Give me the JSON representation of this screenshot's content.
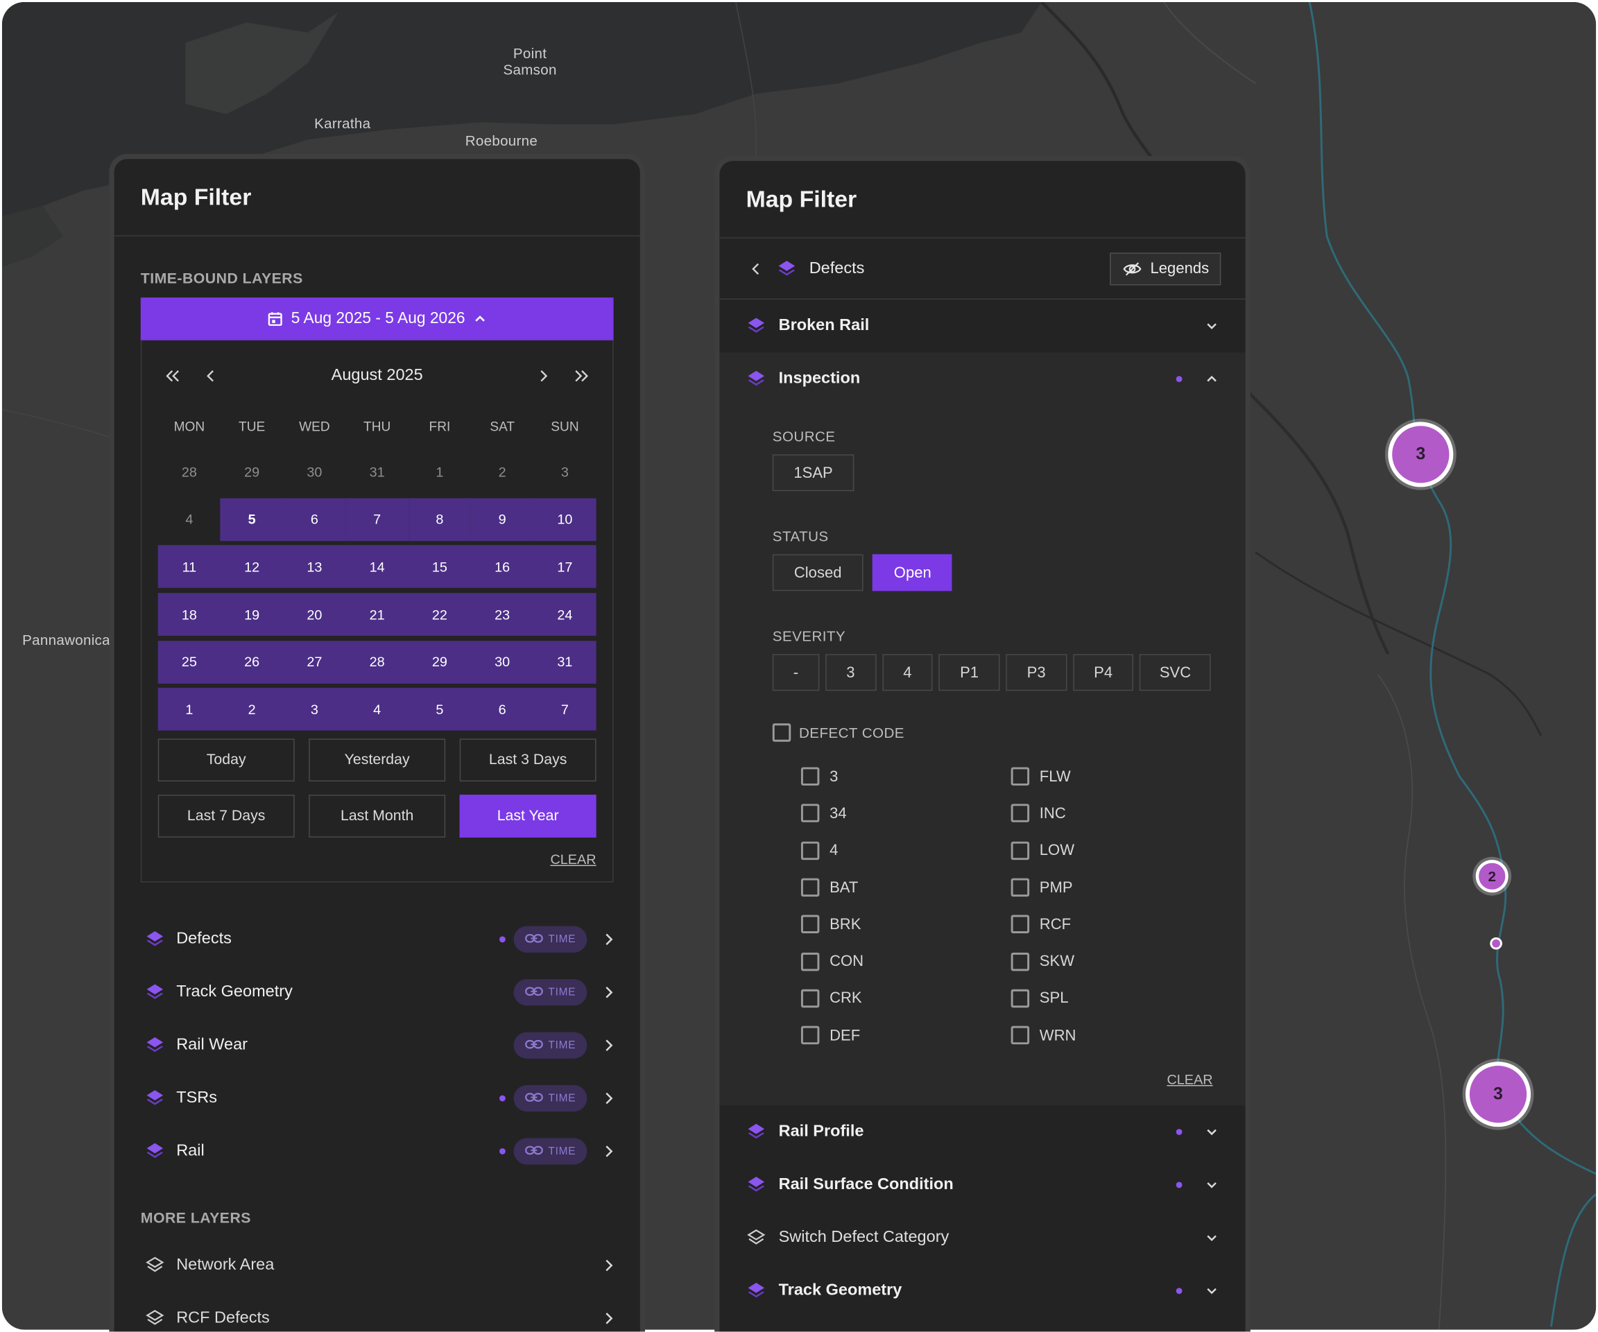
{
  "map": {
    "places": [
      "Point Samson",
      "Karratha",
      "Roebourne",
      "Pannawonica"
    ],
    "clusters": [
      "3",
      "2",
      "3"
    ]
  },
  "left_panel": {
    "title": "Map Filter",
    "section_time_bound": "TIME-BOUND LAYERS",
    "date_range": "5 Aug 2025 - 5 Aug 2026",
    "calendar": {
      "month": "August 2025",
      "dows": [
        "MON",
        "TUE",
        "WED",
        "THU",
        "FRI",
        "SAT",
        "SUN"
      ],
      "weeks": [
        [
          "28",
          "29",
          "30",
          "31",
          "1",
          "2",
          "3"
        ],
        [
          "4",
          "5",
          "6",
          "7",
          "8",
          "9",
          "10"
        ],
        [
          "11",
          "12",
          "13",
          "14",
          "15",
          "16",
          "17"
        ],
        [
          "18",
          "19",
          "20",
          "21",
          "22",
          "23",
          "24"
        ],
        [
          "25",
          "26",
          "27",
          "28",
          "29",
          "30",
          "31"
        ],
        [
          "1",
          "2",
          "3",
          "4",
          "5",
          "6",
          "7"
        ]
      ],
      "selected_day": "5"
    },
    "quick_ranges": [
      "Today",
      "Yesterday",
      "Last 3 Days",
      "Last 7 Days",
      "Last Month",
      "Last Year"
    ],
    "active_quick_range": "Last Year",
    "clear_label": "CLEAR",
    "time_badge": "TIME",
    "layers": [
      {
        "name": "Defects",
        "dot": true
      },
      {
        "name": "Track Geometry",
        "dot": false
      },
      {
        "name": "Rail Wear",
        "dot": false
      },
      {
        "name": "TSRs",
        "dot": true
      },
      {
        "name": "Rail",
        "dot": true
      }
    ],
    "section_more": "MORE LAYERS",
    "more_layers": [
      "Network Area",
      "RCF Defects"
    ]
  },
  "right_panel": {
    "title": "Map Filter",
    "breadcrumb": "Defects",
    "legends_label": "Legends",
    "items_top": [
      "Broken Rail",
      "Inspection"
    ],
    "source_label": "SOURCE",
    "source_options": [
      "1SAP"
    ],
    "status_label": "STATUS",
    "status_options": [
      "Closed",
      "Open"
    ],
    "status_active": "Open",
    "severity_label": "SEVERITY",
    "severity_options": [
      "-",
      "3",
      "4",
      "P1",
      "P3",
      "P4",
      "SVC"
    ],
    "defect_code_label": "DEFECT CODE",
    "defect_codes_left": [
      "3",
      "34",
      "4",
      "BAT",
      "BRK",
      "CON",
      "CRK",
      "DEF"
    ],
    "defect_codes_right": [
      "FLW",
      "INC",
      "LOW",
      "PMP",
      "RCF",
      "SKW",
      "SPL",
      "WRN"
    ],
    "clear_label": "CLEAR",
    "items_bottom": [
      {
        "name": "Rail Profile",
        "dot": true,
        "filled": true
      },
      {
        "name": "Rail Surface Condition",
        "dot": true,
        "filled": true
      },
      {
        "name": "Switch Defect Category",
        "dot": false,
        "filled": false
      },
      {
        "name": "Track Geometry",
        "dot": true,
        "filled": true
      }
    ]
  },
  "colors": {
    "accent": "#7b3ae6",
    "range": "#4c2e86",
    "cluster": "#b35ac9"
  }
}
